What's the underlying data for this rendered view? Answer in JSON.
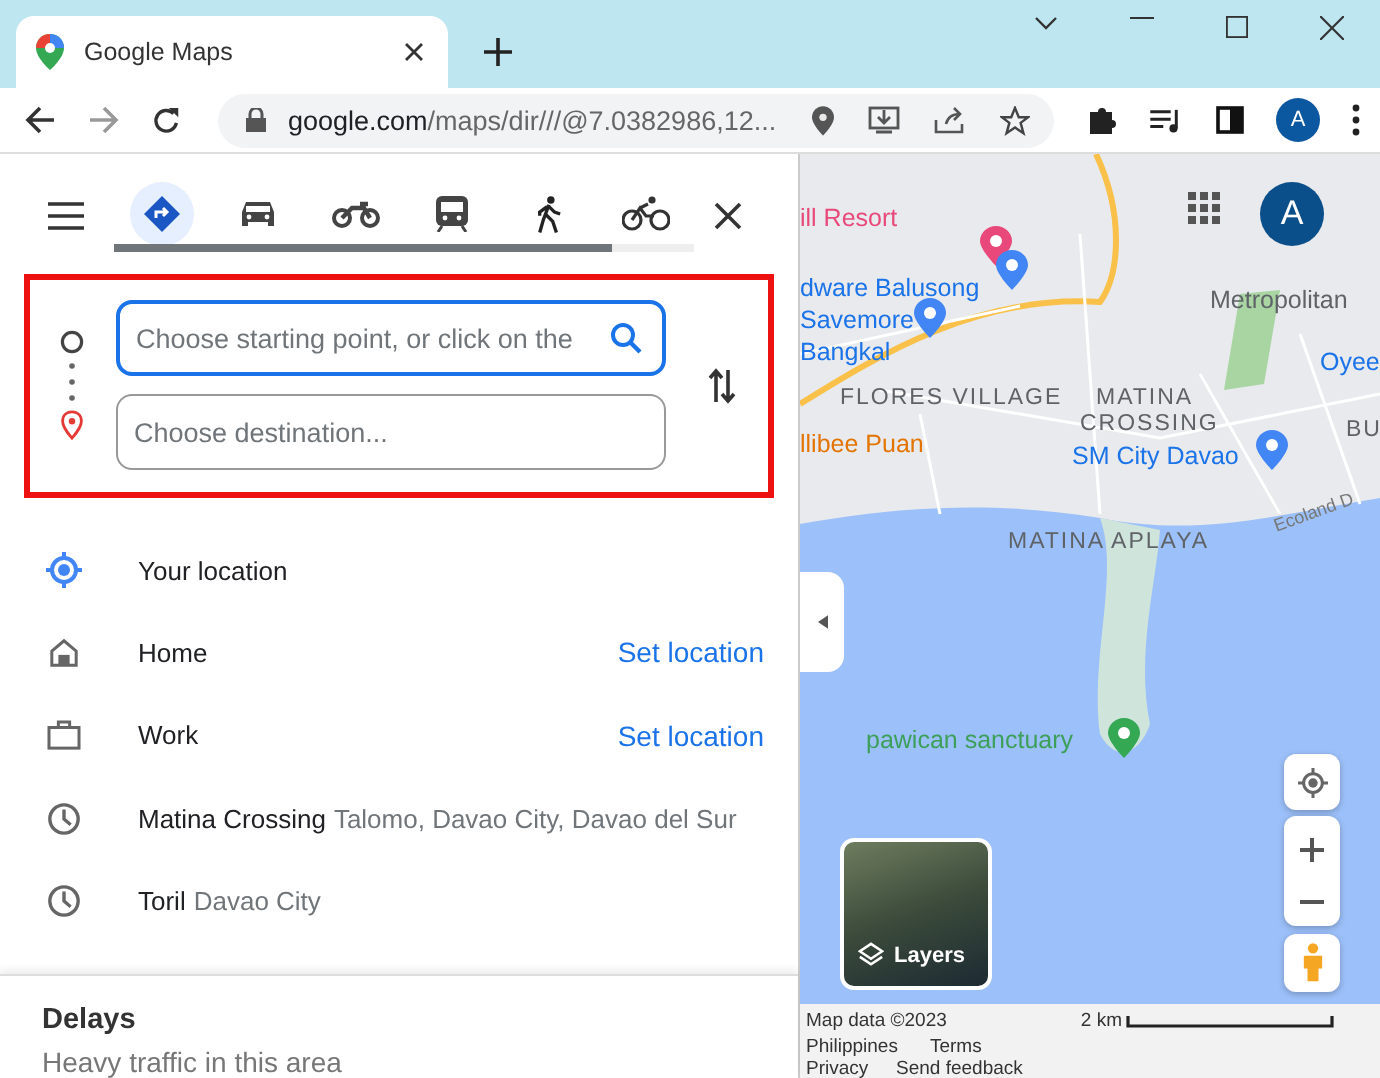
{
  "browser": {
    "tab_title": "Google Maps",
    "url_host": "google.com",
    "url_path": "/maps/dir///@7.0382986,12...",
    "profile": "A"
  },
  "travel_modes": [
    {
      "kind": "best",
      "selected": true
    },
    {
      "kind": "car",
      "selected": false
    },
    {
      "kind": "motorcycle",
      "selected": false
    },
    {
      "kind": "transit",
      "selected": false
    },
    {
      "kind": "walk",
      "selected": false
    },
    {
      "kind": "bike",
      "selected": false
    }
  ],
  "mode_bar": {
    "level": 0.86
  },
  "route": {
    "highlighted": true,
    "start": {
      "placeholder": "Choose starting point, or click on the",
      "focused": true
    },
    "destination": {
      "placeholder": "Choose destination...",
      "focused": false
    }
  },
  "suggestions": [
    {
      "kind": "current",
      "name": "Your location"
    },
    {
      "kind": "home",
      "name": "Home",
      "action": "Set location"
    },
    {
      "kind": "work",
      "name": "Work",
      "action": "Set location"
    },
    {
      "kind": "recent",
      "name": "Matina Crossing",
      "detail": "Talomo, Davao City, Davao del Sur"
    },
    {
      "kind": "recent",
      "name": "Toril",
      "detail": "Davao City"
    }
  ],
  "delays": {
    "title": "Delays",
    "subtitle": "Heavy traffic in this area"
  },
  "map": {
    "avatar": "A",
    "labels": [
      {
        "kind": "red",
        "text": "ill Resort"
      },
      {
        "kind": "blue",
        "text": "dware Balusong"
      },
      {
        "kind": "blue",
        "text": "Savemore"
      },
      {
        "kind": "blue",
        "text": "Bangkal"
      },
      {
        "kind": "gray",
        "text": "Metropolitan"
      },
      {
        "kind": "blue",
        "text": "Oyee"
      },
      {
        "kind": "area",
        "text": "FLORES VILLAGE"
      },
      {
        "kind": "area",
        "text": "MATINA"
      },
      {
        "kind": "area",
        "text": "CROSSING"
      },
      {
        "kind": "area",
        "text": "BU"
      },
      {
        "kind": "orange",
        "text": "llibee Puan"
      },
      {
        "kind": "blue",
        "text": "SM City Davao"
      },
      {
        "kind": "road",
        "text": "Ecoland D"
      },
      {
        "kind": "area",
        "text": "MATINA APLAYA"
      },
      {
        "kind": "green",
        "text": "pawican sanctuary"
      }
    ],
    "layers": "Layers",
    "attribution": "Map data ©2023",
    "scale": "2 km",
    "footer_links": [
      "Philippines",
      "Terms",
      "Privacy",
      "Send feedback"
    ]
  }
}
